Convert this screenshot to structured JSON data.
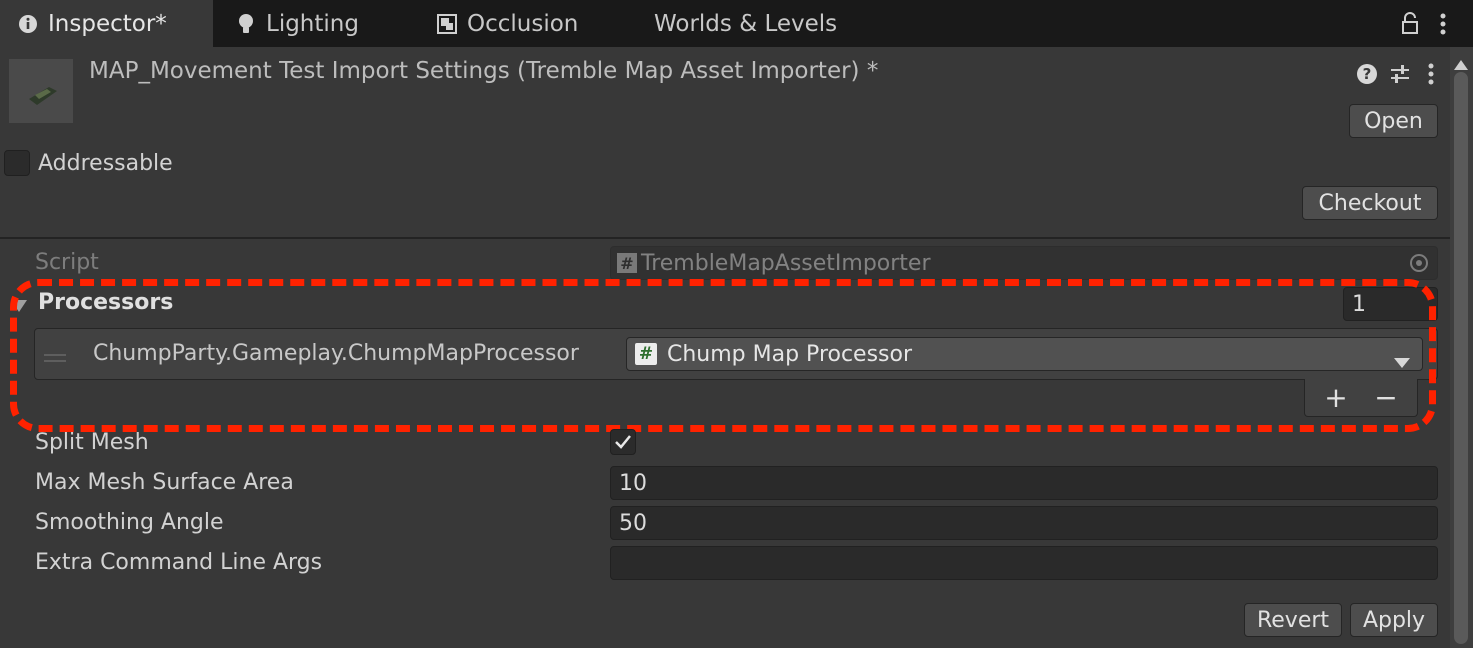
{
  "tabs": [
    {
      "label": "Inspector*",
      "icon": "info-icon"
    },
    {
      "label": "Lighting",
      "icon": "bulb-icon"
    },
    {
      "label": "Occlusion",
      "icon": "occlusion-icon"
    },
    {
      "label": "Worlds & Levels",
      "icon": ""
    }
  ],
  "header": {
    "title": "MAP_Movement Test Import Settings (Tremble Map Asset Importer) *",
    "open_label": "Open"
  },
  "addressable": {
    "label": "Addressable",
    "checked": false
  },
  "checkout_label": "Checkout",
  "script": {
    "label": "Script",
    "value": "TrembleMapAssetImporter"
  },
  "processors": {
    "label": "Processors",
    "count": "1",
    "items": [
      {
        "name": "ChumpParty.Gameplay.ChumpMapProcessor",
        "value": "Chump Map Processor"
      }
    ],
    "add_symbol": "+",
    "remove_symbol": "−"
  },
  "fields": {
    "split_mesh": {
      "label": "Split Mesh",
      "checked": true
    },
    "max_area": {
      "label": "Max Mesh Surface Area",
      "value": "10"
    },
    "smoothing": {
      "label": "Smoothing Angle",
      "value": "50"
    },
    "extra_args": {
      "label": "Extra Command Line Args",
      "value": ""
    }
  },
  "footer": {
    "revert_label": "Revert",
    "apply_label": "Apply"
  },
  "colors": {
    "background": "#383838",
    "tabbar": "#191919",
    "highlight": "#ff2200"
  }
}
